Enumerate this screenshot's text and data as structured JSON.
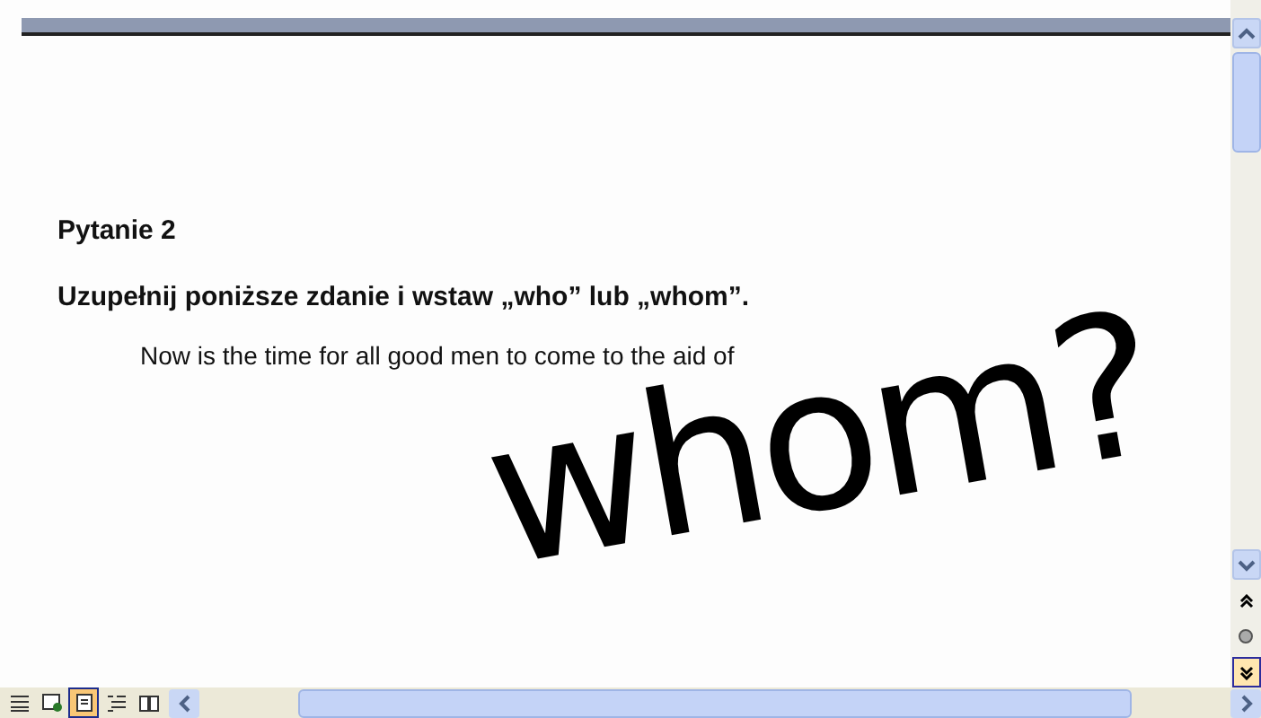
{
  "document": {
    "heading": "Pytanie 2",
    "instruction": "Uzupełnij poniższe zdanie i wstaw „who” lub „whom”.",
    "sentence": "Now is the time for all good men to come to the aid of",
    "ink_annotation": "whom?"
  },
  "view_buttons": [
    {
      "kind": "normal",
      "selected": false
    },
    {
      "kind": "web",
      "selected": false
    },
    {
      "kind": "print",
      "selected": true
    },
    {
      "kind": "outline",
      "selected": false
    },
    {
      "kind": "reading",
      "selected": false
    }
  ]
}
